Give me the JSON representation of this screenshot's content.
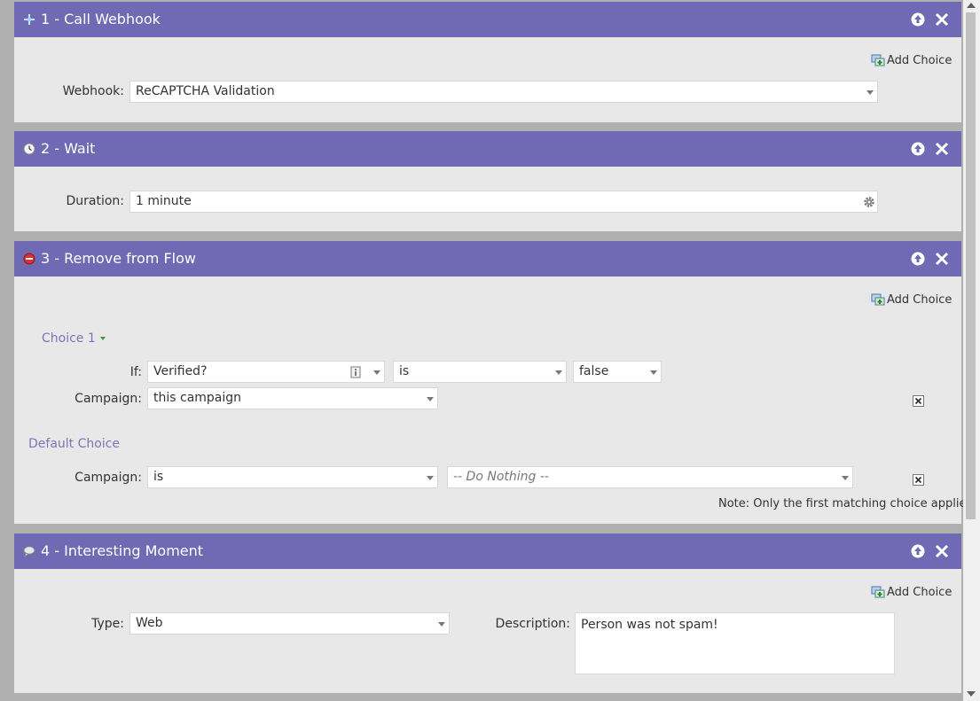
{
  "steps": [
    {
      "title": "1 - Call Webhook",
      "icon": "webhook-icon",
      "add_choice": "Add Choice",
      "fields": {
        "webhook_label": "Webhook:",
        "webhook_value": "ReCAPTCHA Validation"
      }
    },
    {
      "title": "2 - Wait",
      "icon": "clock-icon",
      "fields": {
        "duration_label": "Duration:",
        "duration_value": "1 minute"
      }
    },
    {
      "title": "3 - Remove from Flow",
      "icon": "stop-icon",
      "add_choice": "Add Choice",
      "choice1": {
        "label": "Choice 1",
        "if_label": "If:",
        "field": "Verified?",
        "operator": "is",
        "value": "false",
        "campaign_label": "Campaign:",
        "campaign_value": "this campaign"
      },
      "default_choice": {
        "label": "Default Choice",
        "campaign_label": "Campaign:",
        "operator": "is",
        "value": "-- Do Nothing --"
      },
      "note": "Note: Only the first matching choice applies"
    },
    {
      "title": "4 - Interesting Moment",
      "icon": "speech-bubble-icon",
      "add_choice": "Add Choice",
      "fields": {
        "type_label": "Type:",
        "type_value": "Web",
        "description_label": "Description:",
        "description_value": "Person was not spam!"
      }
    }
  ],
  "colors": {
    "header": "#6f6ab3",
    "panel": "#e8e8e8",
    "section_label": "#7a76b8"
  }
}
